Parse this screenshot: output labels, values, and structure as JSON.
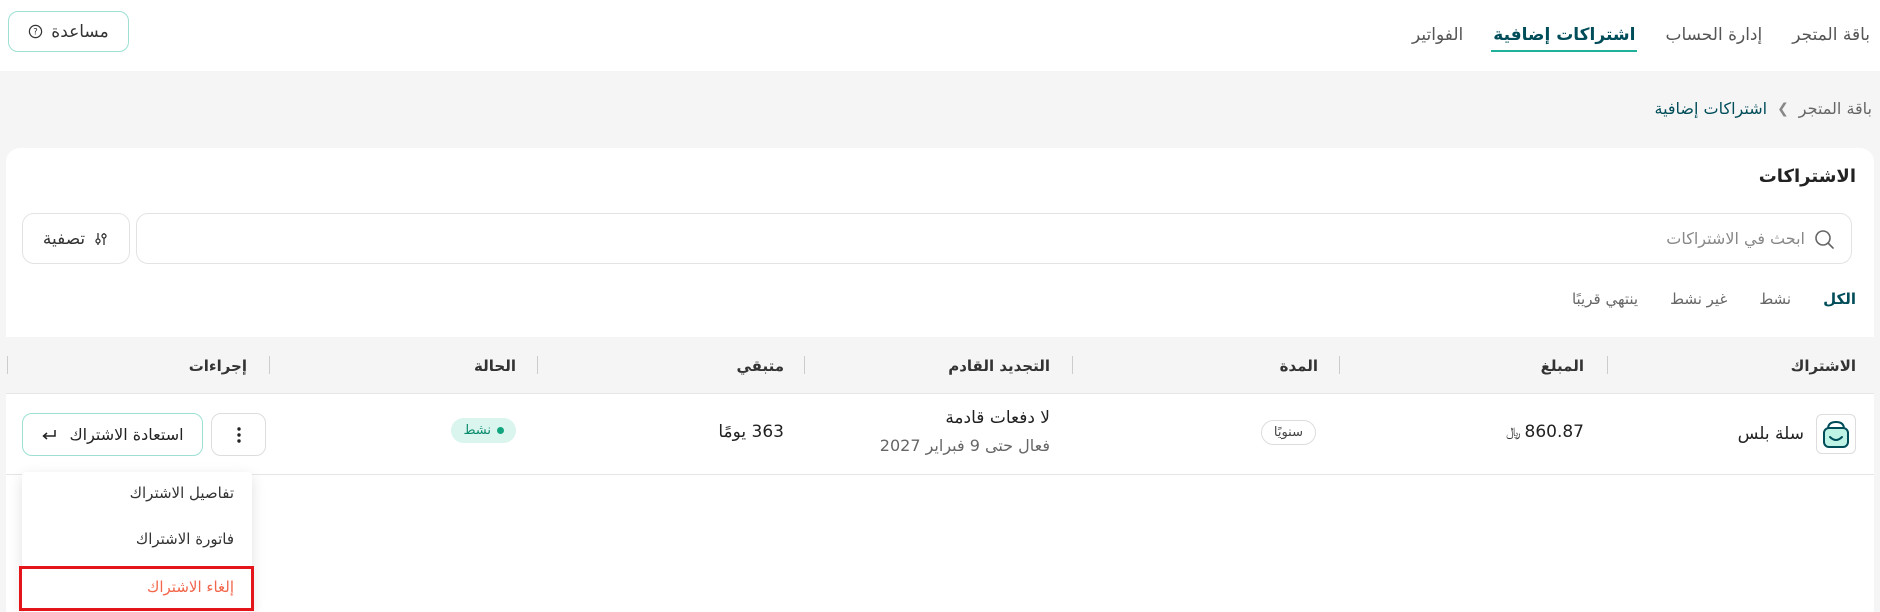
{
  "top_nav": {
    "tabs": [
      "باقة المتجر",
      "إدارة الحساب",
      "اشتراكات إضافية",
      "الفواتير"
    ],
    "active_tab": "اشتراكات إضافية"
  },
  "help_button": {
    "label": "مساعدة",
    "icon": "help-circle-icon"
  },
  "breadcrumb": {
    "parent": "باقة المتجر",
    "current": "اشتراكات إضافية"
  },
  "page": {
    "title": "الاشتراكات"
  },
  "search": {
    "placeholder": "ابحث في الاشتراكات",
    "value": ""
  },
  "filter_button": {
    "label": "تصفية",
    "icon": "sliders-icon"
  },
  "status_tabs": {
    "all": "الكل",
    "active": "نشط",
    "inactive": "غير نشط",
    "expiring": "ينتهي قريبًا",
    "selected": "الكل"
  },
  "table": {
    "headers": {
      "subscription": "الاشتراك",
      "amount": "المبلغ",
      "period": "المدة",
      "next_renewal": "التجديد القادم",
      "remaining": "متبقي",
      "status": "الحالة",
      "actions": "إجراءات"
    },
    "rows": [
      {
        "name": "سلة بلس",
        "logo_icon": "salla-bag-icon",
        "amount": "860.87",
        "currency_symbol": "﷼",
        "period": "سنويًا",
        "renewal_main": "لا دفعات قادمة",
        "renewal_sub": "فعال حتى 9 فبراير 2027",
        "remaining": "363 يومًا",
        "status": "نشط",
        "restore_label": "استعادة الاشتراك"
      }
    ]
  },
  "dropdown": {
    "items": {
      "details": "تفاصيل الاشتراك",
      "invoice": "فاتورة الاشتراك",
      "cancel": "إلغاء الاشتراك"
    }
  },
  "colors": {
    "accent": "#004d5a",
    "teal_border": "#9de0d3",
    "status_bg": "#d9f5ed",
    "status_text": "#0a8a6d",
    "danger": "#f2664b",
    "highlight": "#e4141b"
  }
}
